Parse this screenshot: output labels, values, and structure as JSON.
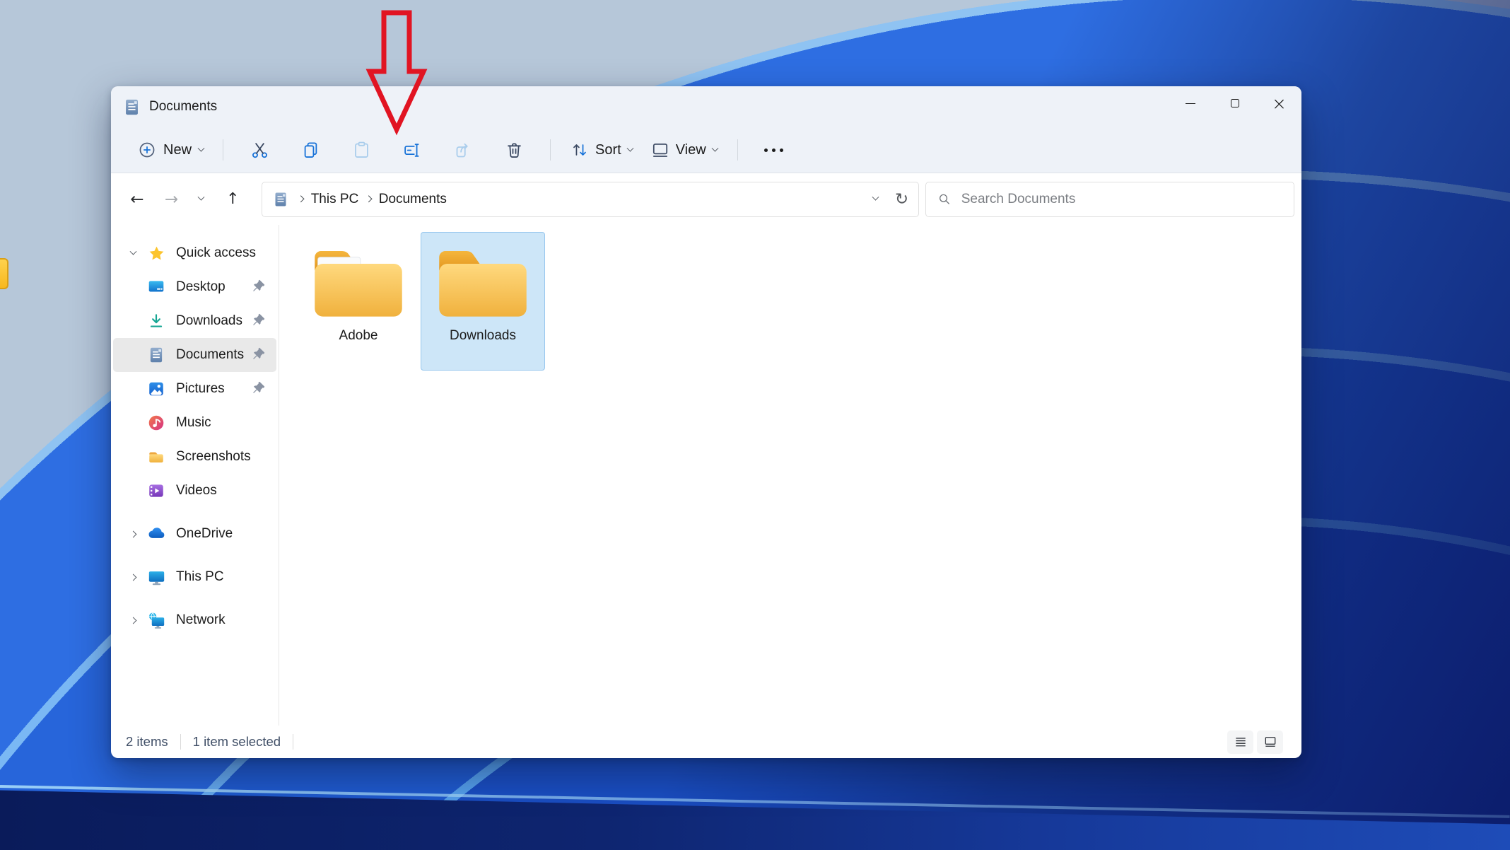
{
  "window": {
    "title": "Documents"
  },
  "toolbar": {
    "new_label": "New",
    "sort_label": "Sort",
    "view_label": "View"
  },
  "addressbar": {
    "breadcrumb": [
      "This PC",
      "Documents"
    ],
    "search_placeholder": "Search Documents"
  },
  "sidebar": {
    "items": [
      {
        "label": "Quick access",
        "pinned": false,
        "selected": false
      },
      {
        "label": "Desktop",
        "pinned": true,
        "selected": false
      },
      {
        "label": "Downloads",
        "pinned": true,
        "selected": false
      },
      {
        "label": "Documents",
        "pinned": true,
        "selected": true
      },
      {
        "label": "Pictures",
        "pinned": true,
        "selected": false
      },
      {
        "label": "Music",
        "pinned": false,
        "selected": false
      },
      {
        "label": "Screenshots",
        "pinned": false,
        "selected": false
      },
      {
        "label": "Videos",
        "pinned": false,
        "selected": false
      },
      {
        "label": "OneDrive",
        "pinned": false,
        "selected": false
      },
      {
        "label": "This PC",
        "pinned": false,
        "selected": false
      },
      {
        "label": "Network",
        "pinned": false,
        "selected": false
      }
    ]
  },
  "content": {
    "folders": [
      {
        "name": "Adobe",
        "selected": false
      },
      {
        "name": "Downloads",
        "selected": true
      }
    ]
  },
  "statusbar": {
    "count": "2 items",
    "selection": "1 item selected"
  },
  "colors": {
    "accent_blue": "#1772d8",
    "chrome_bg": "#eef2f8",
    "selection_fill": "#cde6f8",
    "selection_border": "#98c7ee",
    "annotation_red": "#e11422"
  }
}
